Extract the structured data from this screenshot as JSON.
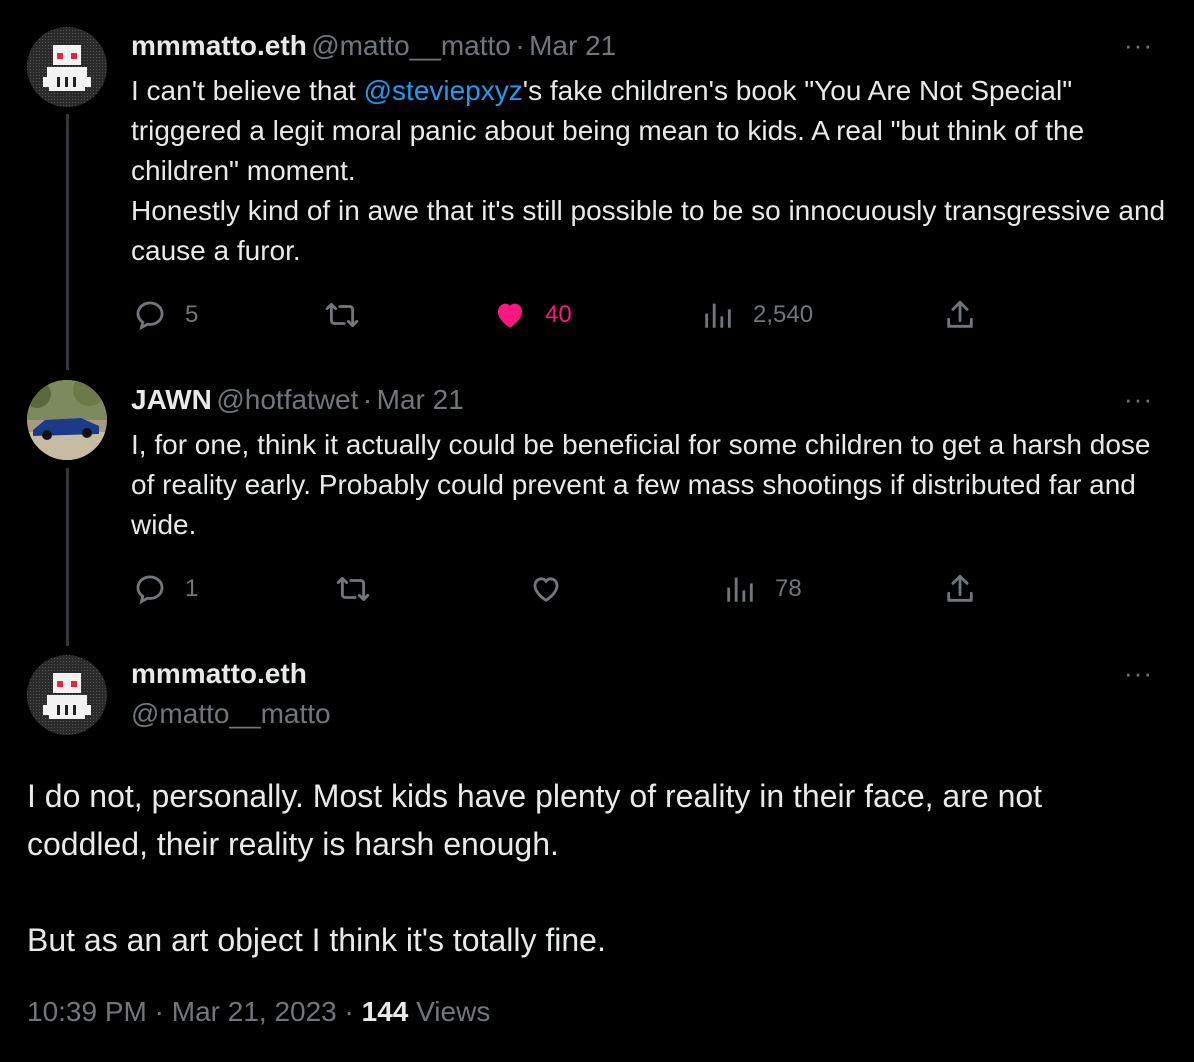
{
  "tweets": [
    {
      "display_name": "mmmatto.eth",
      "handle": "@matto__matto",
      "sep": "·",
      "date": "Mar 21",
      "text_pre": "I can't believe that ",
      "mention": "@steviepxyz",
      "text_post": "'s fake children's book \"You Are Not Special\" triggered a legit moral panic about being mean to kids. A real \"but think of the children\" moment.\nHonestly kind of in awe that it's still possible to be so innocuously transgressive and cause a furor.",
      "replies": "5",
      "likes": "40",
      "views": "2,540",
      "liked": true
    },
    {
      "display_name": "JAWN",
      "handle": "@hotfatwet",
      "sep": "·",
      "date": "Mar 21",
      "text": "I, for one, think it actually could be beneficial for some children to get a harsh dose of reality early. Probably could prevent a few mass shootings if distributed far and wide.",
      "replies": "1",
      "views": "78",
      "liked": false
    }
  ],
  "main_tweet": {
    "display_name": "mmmatto.eth",
    "handle": "@matto__matto",
    "text": "I do not, personally. Most kids have plenty of reality in their face, are not coddled, their reality is harsh enough.\n\nBut as an art object I think it's totally fine.",
    "time": "10:39 PM",
    "sep": "·",
    "date": "Mar 21, 2023",
    "views_count": "144",
    "views_label": "Views"
  },
  "more_glyph": "···",
  "colors": {
    "accent": "#1d9bf0",
    "like": "#f91880",
    "muted": "#71767b",
    "text": "#e7e9ea"
  },
  "icons": [
    "reply-icon",
    "retweet-icon",
    "like-icon",
    "views-icon",
    "share-icon",
    "more-icon"
  ]
}
